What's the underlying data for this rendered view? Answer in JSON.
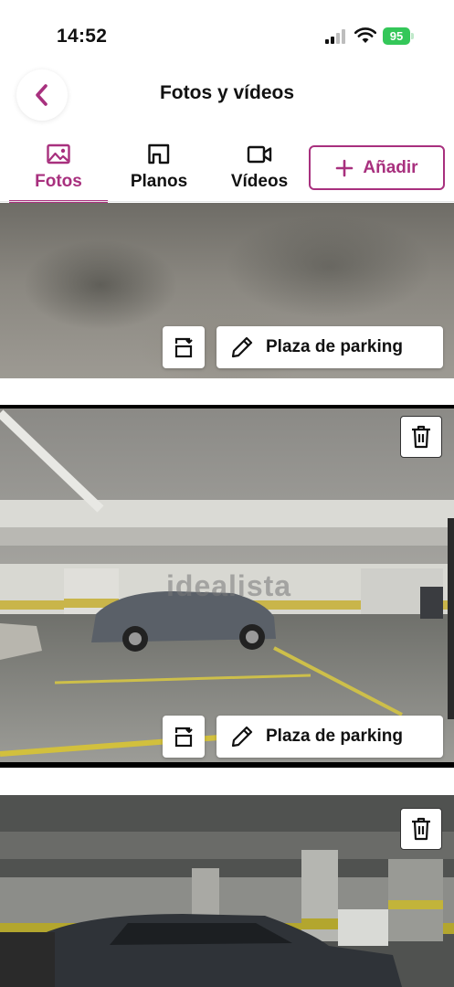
{
  "status_bar": {
    "time": "14:52",
    "battery": "95",
    "icons": [
      "signal-icon",
      "wifi-icon",
      "battery-icon"
    ]
  },
  "header": {
    "title": "Fotos y vídeos",
    "back_icon": "chevron-left-icon"
  },
  "tabs": [
    {
      "label": "Fotos",
      "icon": "image-icon",
      "active": true
    },
    {
      "label": "Planos",
      "icon": "floorplan-icon",
      "active": false
    },
    {
      "label": "Vídeos",
      "icon": "video-camera-icon",
      "active": false
    }
  ],
  "add_button": {
    "label": "Añadir",
    "icon": "plus-icon"
  },
  "photos": [
    {
      "label": "Plaza de parking",
      "actions": [
        "rotate-icon",
        "pencil-icon"
      ]
    },
    {
      "label": "Plaza de parking",
      "watermark": "idealista",
      "actions": [
        "trash-icon",
        "rotate-icon",
        "pencil-icon"
      ]
    },
    {
      "actions": [
        "trash-icon"
      ]
    }
  ],
  "colors": {
    "accent": "#a8307e",
    "battery": "#34c759"
  }
}
